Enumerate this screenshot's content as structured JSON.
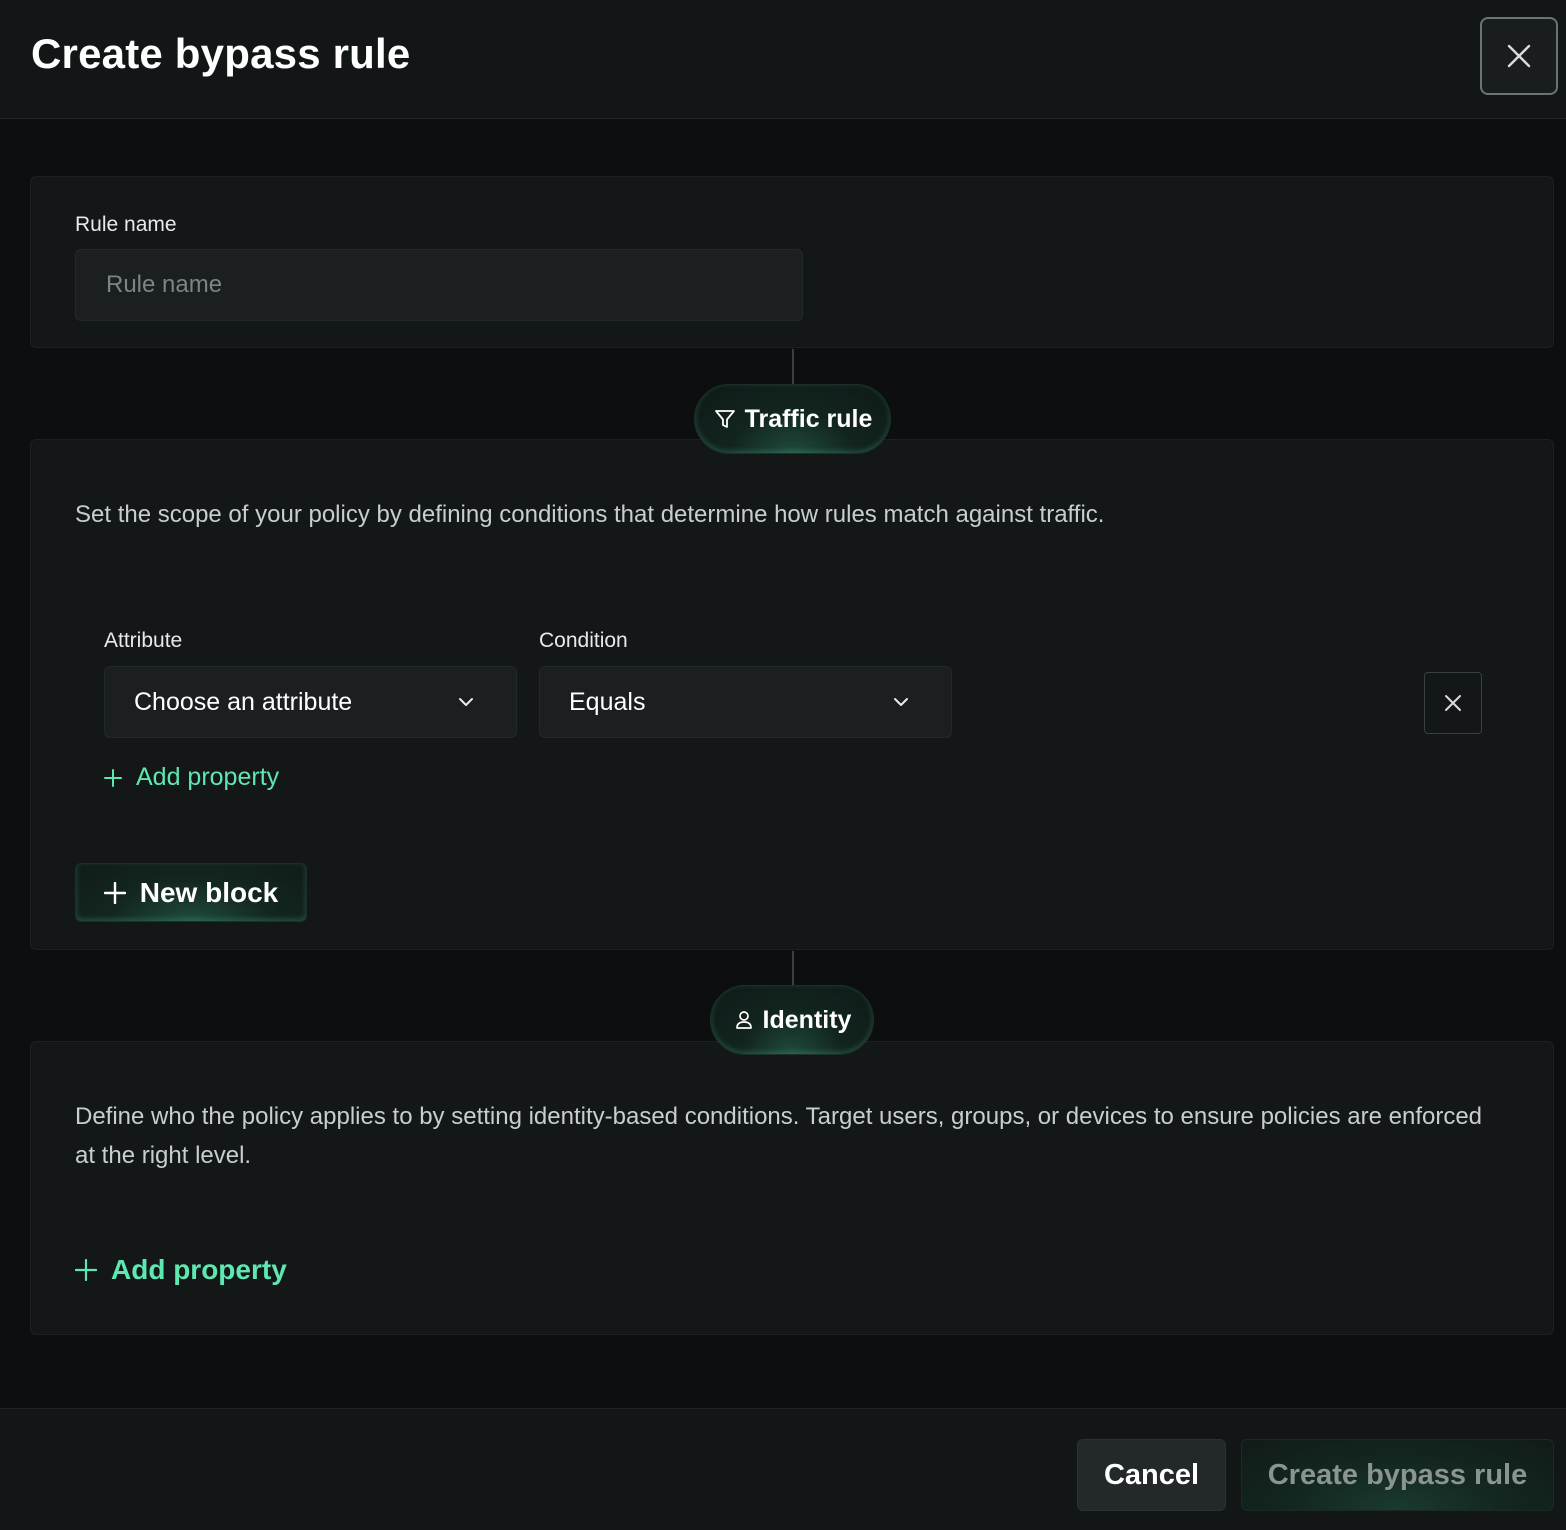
{
  "header": {
    "title": "Create bypass rule",
    "close_icon": "close-icon"
  },
  "rule_name": {
    "label": "Rule name",
    "placeholder": "Rule name",
    "value": ""
  },
  "traffic": {
    "pill_label": "Traffic rule",
    "pill_icon": "filter-icon",
    "description": "Set the scope of your policy by defining conditions that determine how rules match against traffic.",
    "attribute_label": "Attribute",
    "attribute_value": "Choose an attribute",
    "condition_label": "Condition",
    "condition_value": "Equals",
    "add_property_label": "Add property",
    "new_block_label": "New block"
  },
  "identity": {
    "pill_label": "Identity",
    "pill_icon": "user-icon",
    "description": "Define who the policy applies to by setting identity-based conditions. Target users, groups, or devices to ensure policies are enforced at the right level.",
    "add_property_label": "Add property"
  },
  "footer": {
    "cancel_label": "Cancel",
    "create_label": "Create bypass rule"
  },
  "colors": {
    "accent": "#5ee8b0",
    "background": "#0c0e0f",
    "panel": "#141718"
  }
}
